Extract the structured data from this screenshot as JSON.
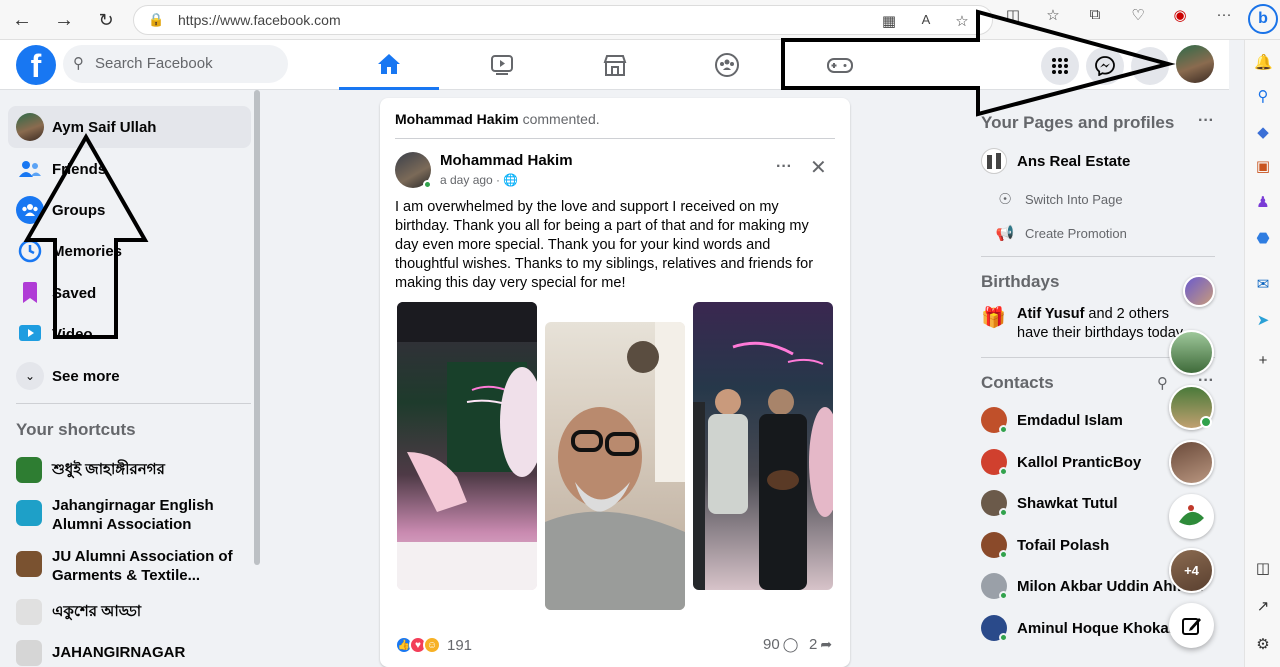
{
  "browser": {
    "url": "https://www.facebook.com",
    "back_icon": "arrow-left-icon",
    "forward_icon": "arrow-right-icon",
    "refresh_icon": "refresh-icon",
    "menu_glyph": "···",
    "bing_letter": "b"
  },
  "header": {
    "logo_letter": "f",
    "search_placeholder": "Search Facebook",
    "accent": "#1877f2",
    "tabs": [
      "home-icon",
      "video-icon",
      "marketplace-icon",
      "groups-icon",
      "gaming-icon"
    ],
    "right_buttons": [
      "menu-grid-icon",
      "messenger-icon",
      "notifications-icon",
      "profile-avatar"
    ]
  },
  "left": {
    "items": [
      {
        "label": "Aym Saif Ullah"
      },
      {
        "label": "Friends"
      },
      {
        "label": "Groups"
      },
      {
        "label": "Memories"
      },
      {
        "label": "Saved"
      },
      {
        "label": "Video"
      },
      {
        "label": "See more"
      }
    ],
    "shortcuts_heading": "Your shortcuts",
    "shortcuts": [
      {
        "label": "শুধুই জাহাঙ্গীরনগর"
      },
      {
        "label": "Jahangirnagar English Alumni Association"
      },
      {
        "label": "JU Alumni Association of Garments & Textile..."
      },
      {
        "label": "একুশের আড্ডা"
      },
      {
        "label": "JAHANGIRNAGAR"
      }
    ]
  },
  "post": {
    "commenter": "Mohammad Hakim",
    "commented_text": "commented.",
    "author": "Mohammad Hakim",
    "time": "a day ago · ",
    "more_glyph": "···",
    "close_glyph": "✕",
    "body": "I am overwhelmed by the love and support I received on my birthday. Thank you all for being a part of that and for making my day even more special. Thank you for your kind words and thoughtful wishes. Thanks to my siblings, relatives and friends for making this day very special for me!",
    "reactions_count": "191",
    "comments_count": "90",
    "shares_count": "2"
  },
  "right": {
    "pages_heading": "Your Pages and profiles",
    "dots": "···",
    "page_name": "Ans Real Estate",
    "switch_label": "Switch Into Page",
    "promo_label": "Create Promotion",
    "birthdays_heading": "Birthdays",
    "birthday_name": "Atif Yusuf",
    "birthday_rest": " and 2 others have their birthdays today.",
    "contacts_heading": "Contacts",
    "contacts": [
      {
        "name": "Emdadul Islam"
      },
      {
        "name": "Kallol PranticBoy"
      },
      {
        "name": "Shawkat Tutul"
      },
      {
        "name": "Tofail Polash"
      },
      {
        "name": "Milon Akbar Uddin Ahmed"
      },
      {
        "name": "Aminul Hoque Khokan"
      }
    ],
    "more_chats": "+4"
  }
}
